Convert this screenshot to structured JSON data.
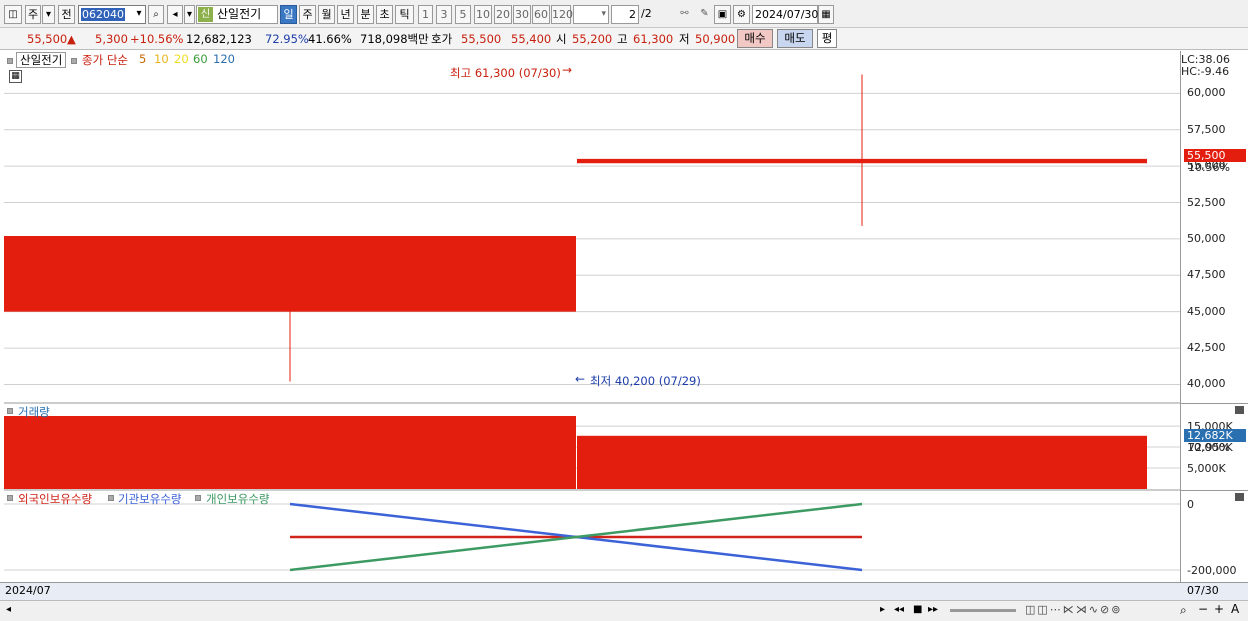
{
  "toolbar": {
    "btn_week_label": "주",
    "btn_prev_label": "전",
    "code_value": "062040",
    "name_badge": "신",
    "name_value": "산일전기",
    "periods": [
      "일",
      "주",
      "월",
      "년",
      "분",
      "초",
      "틱"
    ],
    "active_period": "일",
    "intervals": [
      "1",
      "3",
      "5",
      "10",
      "20",
      "30",
      "60",
      "120"
    ],
    "page_value": "2",
    "page_total": "/2",
    "date_value": "2024/07/30"
  },
  "infobar": {
    "price": "55,500",
    "change_arrow": "▲",
    "change": "5,300",
    "change_pct": "+10.56%",
    "volume": "12,682,123",
    "ratio1": "72.95%",
    "ratio2": "41.66%",
    "trade_value": "718,098백만",
    "quote_label": "호가",
    "ask": "55,500",
    "bid": "55,400",
    "open_label": "시",
    "open": "55,200",
    "high_label": "고",
    "high": "61,300",
    "low_label": "저",
    "low": "50,900",
    "buy_label": "매수",
    "sell_label": "매도",
    "eval_label": "평"
  },
  "price_panel": {
    "stock_label": "산일전기",
    "ma_label": "종가 단순",
    "ma_periods": [
      "5",
      "10",
      "20",
      "60",
      "120"
    ],
    "ma_colors": [
      "#d8871a",
      "#e6c21a",
      "#f0e020",
      "#3c9a3c",
      "#2a6fb0"
    ],
    "high_annotation": "최고 61,300 (07/30)",
    "low_annotation": "최저 40,200 (07/29)",
    "lc_label": "LC:38.06",
    "hc_label": "HC:-9.46",
    "current_tag": "55,500",
    "current_pct": "10.56%"
  },
  "volume_panel": {
    "label": "거래량",
    "current_tag": "12,682K",
    "current_pct": "72.95%"
  },
  "holding_panel": {
    "legends": [
      "외국인보유수량",
      "기관보유수량",
      "개인보유수량"
    ]
  },
  "bottom": {
    "left_date": "2024/07",
    "right_date": "07/30"
  },
  "chart_data": [
    {
      "type": "candlestick",
      "dates": [
        "07/29",
        "07/30"
      ],
      "open": [
        45000,
        55200
      ],
      "high": [
        50200,
        61300
      ],
      "low": [
        40200,
        50900
      ],
      "close": [
        50200,
        55500
      ],
      "y_ticks": [
        "40,000",
        "42,500",
        "45,000",
        "47,500",
        "50,000",
        "52,500",
        "55,000",
        "57,500",
        "60,000"
      ],
      "ylim": [
        39000,
        62500
      ],
      "colors": {
        "up": "#e31e0e"
      }
    },
    {
      "type": "bar",
      "title": "거래량",
      "categories": [
        "07/29",
        "07/30"
      ],
      "values": [
        17400000,
        12682123
      ],
      "y_ticks": [
        "5,000K",
        "10,000K",
        "15,000K"
      ],
      "ylim": [
        0,
        17400000
      ],
      "color": "#e31e0e"
    },
    {
      "type": "line",
      "x": [
        "07/29",
        "07/30"
      ],
      "series": [
        {
          "name": "외국인보유수량",
          "values": [
            -100000,
            -100000
          ],
          "color": "#d0241a"
        },
        {
          "name": "기관보유수량",
          "values": [
            0,
            -200000
          ],
          "color": "#3c62d8"
        },
        {
          "name": "개인보유수량",
          "values": [
            -200000,
            0
          ],
          "color": "#3c9a62"
        }
      ],
      "y_ticks": [
        "0",
        "-200,000"
      ],
      "ylim": [
        -200000,
        0
      ]
    }
  ]
}
